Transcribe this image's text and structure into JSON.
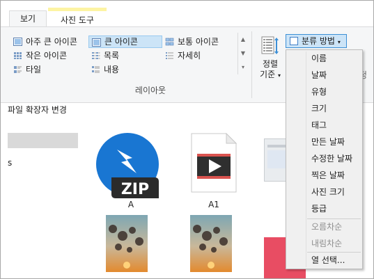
{
  "tabs": [
    {
      "label": "보기",
      "active": true
    },
    {
      "label": "사진 도구",
      "active": false
    }
  ],
  "layout_group": {
    "label": "레이아웃",
    "items": [
      {
        "label": "아주 큰 아이콘",
        "icon": "extra-large-icons-icon",
        "selected": false
      },
      {
        "label": "큰 아이콘",
        "icon": "large-icons-icon",
        "selected": true
      },
      {
        "label": "보통 아이콘",
        "icon": "medium-icons-icon",
        "selected": false
      },
      {
        "label": "작은 아이콘",
        "icon": "small-icons-icon",
        "selected": false
      },
      {
        "label": "목록",
        "icon": "list-icon",
        "selected": false
      },
      {
        "label": "자세히",
        "icon": "details-icon",
        "selected": false
      },
      {
        "label": "타일",
        "icon": "tiles-icon",
        "selected": false
      },
      {
        "label": "내용",
        "icon": "content-icon",
        "selected": false
      }
    ]
  },
  "sort_by": {
    "line1": "정렬",
    "line2": "기준"
  },
  "group_by": {
    "label": "분류 방법"
  },
  "right_cut_text": "정",
  "status": {
    "extension_text": "파일 확장자 변경"
  },
  "left_pane": {
    "item_text": "s"
  },
  "files": [
    {
      "name": "A",
      "icon": "zip-icon"
    },
    {
      "name": "A1",
      "icon": "video-file-icon"
    }
  ],
  "group_menu": {
    "items": [
      "이름",
      "날짜",
      "유형",
      "크기",
      "태그",
      "만든 날짜",
      "수정한 날짜",
      "찍은 날짜",
      "사진 크기",
      "등급"
    ],
    "order_items": [
      "오름차순",
      "내림차순"
    ],
    "choose_columns": "열 선택..."
  },
  "colors": {
    "accent": "#3c8fd6",
    "selected_bg": "#cce4f7",
    "zip_blue": "#1976d2",
    "photo_tools_tab": "#fdf4a3"
  }
}
